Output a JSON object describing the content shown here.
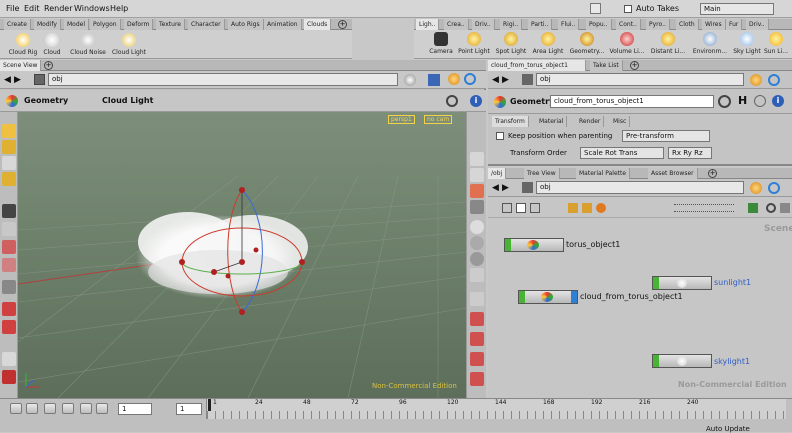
{
  "menu": [
    "File",
    "Edit",
    "Render",
    "Windows",
    "Help"
  ],
  "top_right": {
    "auto_takes": "Auto Takes",
    "desktop": "Main"
  },
  "shelf_left": {
    "tabs": [
      "Create",
      "Modify",
      "Model",
      "Polygon",
      "Deform",
      "Texture",
      "Character",
      "Auto Rigs",
      "Animation",
      "Clouds"
    ],
    "tools": [
      "Cloud Rig",
      "Cloud",
      "Cloud Noise",
      "Cloud Light"
    ]
  },
  "shelf_right": {
    "tabs": [
      "Ligh..",
      "Crea..",
      "Driv..",
      "Rigi..",
      "Parti..",
      "Flui..",
      "Popu..",
      "Cont..",
      "Pyro..",
      "Cloth",
      "Wires",
      "Fur",
      "Driv.."
    ],
    "tools": [
      "Camera",
      "Point Light",
      "Spot Light",
      "Area Light",
      "Geometry...",
      "Volume Li...",
      "Distant Li...",
      "Environm...",
      "Sky Light",
      "Sun Li..."
    ]
  },
  "scene_view": {
    "tab": "Scene View",
    "path": "obj",
    "context": "Geometry",
    "title": "Cloud Light",
    "cam_label": "persp1",
    "cam_menu": "no cam",
    "watermark": "Non-Commercial Edition"
  },
  "params": {
    "tabs_top": [
      "cloud_from_torus_object1",
      "Take List"
    ],
    "path": "obj",
    "type": "Geometry",
    "name": "cloud_from_torus_object1",
    "sections": [
      "Transform",
      "Material",
      "Render",
      "Misc"
    ],
    "keep_position": "Keep position when parenting",
    "pre_transform": "Pre-transform",
    "xform_order_label": "Transform Order",
    "xform_order": "Scale Rot Trans",
    "rot_order": "Rx Ry Rz"
  },
  "network": {
    "tabs": [
      "/obj",
      "Tree View",
      "Material Palette",
      "Asset Browser"
    ],
    "path": "obj",
    "scene_label": "Scene",
    "watermark": "Non-Commercial Edition",
    "nodes": [
      "torus_object1",
      "cloud_from_torus_object1",
      "sunlight1",
      "skylight1"
    ]
  },
  "timeline": {
    "frame": "1",
    "start": "1",
    "ticks": [
      "1",
      "24",
      "48",
      "72",
      "96",
      "120",
      "144",
      "168",
      "192",
      "216",
      "240"
    ],
    "auto_update": "Auto Update"
  },
  "colors": {
    "grid_bg": "#6d806a",
    "node_green": "#49b336",
    "node_blue": "#2e7fd6",
    "light_blue": "#2f5fc7"
  }
}
